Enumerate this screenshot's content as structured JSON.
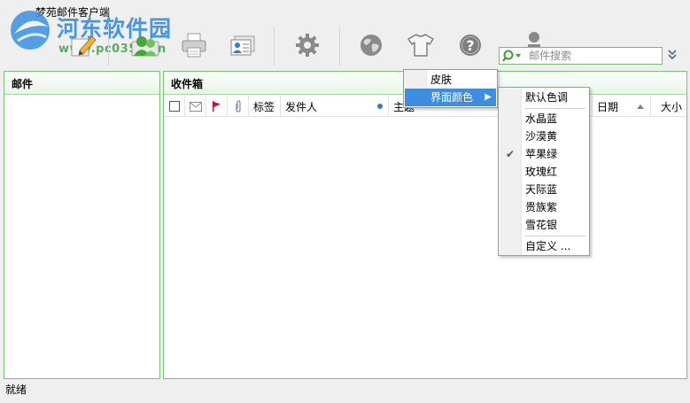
{
  "app_title": "梦苑邮件客户端",
  "watermark": {
    "text": "河东软件园",
    "url": "www.pc0359.cn"
  },
  "toolbar": {
    "buttons": [
      {
        "icon": "pencil-compose-icon",
        "label": "撰写"
      },
      {
        "icon": "contacts-people-icon",
        "label": "联系人"
      },
      {
        "icon": "printer-icon",
        "label": "打印"
      },
      {
        "icon": "address-card-icon",
        "label": "名片"
      },
      {
        "icon": "gear-icon",
        "label": "设置"
      },
      {
        "icon": "globe-icon",
        "label": "网络"
      },
      {
        "icon": "tshirt-skin-icon",
        "label": "皮肤"
      },
      {
        "icon": "help-question-icon",
        "label": "帮助"
      },
      {
        "icon": "user-avatar-icon",
        "label": "账户"
      }
    ]
  },
  "search": {
    "placeholder": "邮件搜索",
    "value": ""
  },
  "panels": {
    "mail": {
      "title": "邮件"
    },
    "inbox": {
      "title": "收件箱"
    }
  },
  "columns": {
    "tag": "标签",
    "sender": "发件人",
    "subject": "主题",
    "date": "日期",
    "size": "大小"
  },
  "skin_menu": {
    "items": [
      {
        "label": "皮肤",
        "selected": false
      },
      {
        "label": "界面颜色",
        "selected": true,
        "has_submenu": true
      }
    ]
  },
  "color_menu": {
    "items": [
      {
        "label": "默认色调",
        "checked": false
      },
      {
        "label": "水晶蓝",
        "checked": false
      },
      {
        "label": "沙漠黄",
        "checked": false
      },
      {
        "label": "苹果绿",
        "checked": true
      },
      {
        "label": "玫瑰红",
        "checked": false
      },
      {
        "label": "天际蓝",
        "checked": false
      },
      {
        "label": "贵族紫",
        "checked": false
      },
      {
        "label": "雪花银",
        "checked": false
      },
      {
        "label": "自定义 ...",
        "checked": false
      }
    ]
  },
  "status": {
    "text": "就绪"
  },
  "colors": {
    "panel_border": "#7fbf7a",
    "menu_highlight": "#3d8ee0",
    "flag": "#c0143c",
    "watermark_blue": "#3a8fe0",
    "watermark_green": "#5fa862"
  }
}
